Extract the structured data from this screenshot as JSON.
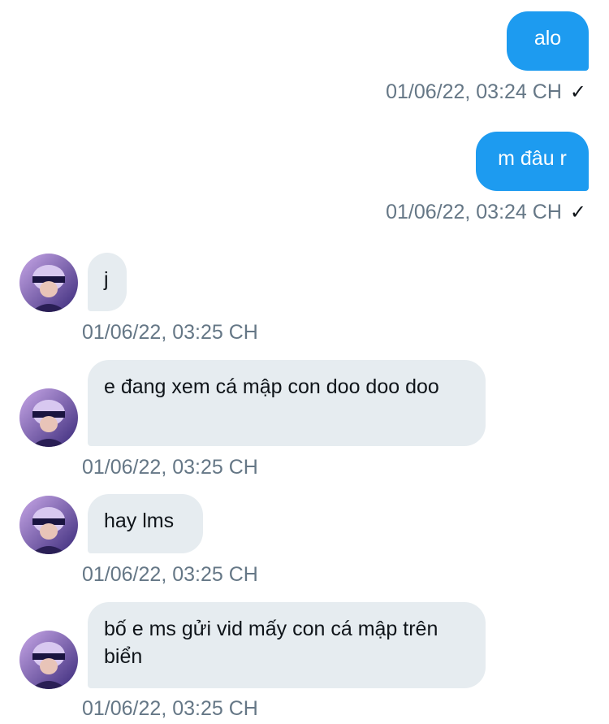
{
  "messages": [
    {
      "direction": "out",
      "text": "alo",
      "time": "01/06/22, 03:24 CH",
      "read_mark": "✓"
    },
    {
      "direction": "out",
      "text": "m đâu r",
      "time": "01/06/22, 03:24 CH",
      "read_mark": "✓"
    },
    {
      "direction": "in",
      "text": "j",
      "time": "01/06/22, 03:25 CH"
    },
    {
      "direction": "in",
      "text": "e đang xem cá mập con doo doo doo",
      "time": "01/06/22, 03:25 CH"
    },
    {
      "direction": "in",
      "text": "hay lms",
      "time": "01/06/22, 03:25 CH"
    },
    {
      "direction": "in",
      "text": "bố e ms gửi vid mấy con cá mập trên biển",
      "time": "01/06/22, 03:25 CH"
    }
  ],
  "colors": {
    "outgoing_bubble": "#1d9bf0",
    "incoming_bubble": "#e6ecf0",
    "timestamp": "#657786"
  },
  "icons": {
    "read_mark": "checkmark-icon",
    "avatar": "contact-avatar"
  }
}
